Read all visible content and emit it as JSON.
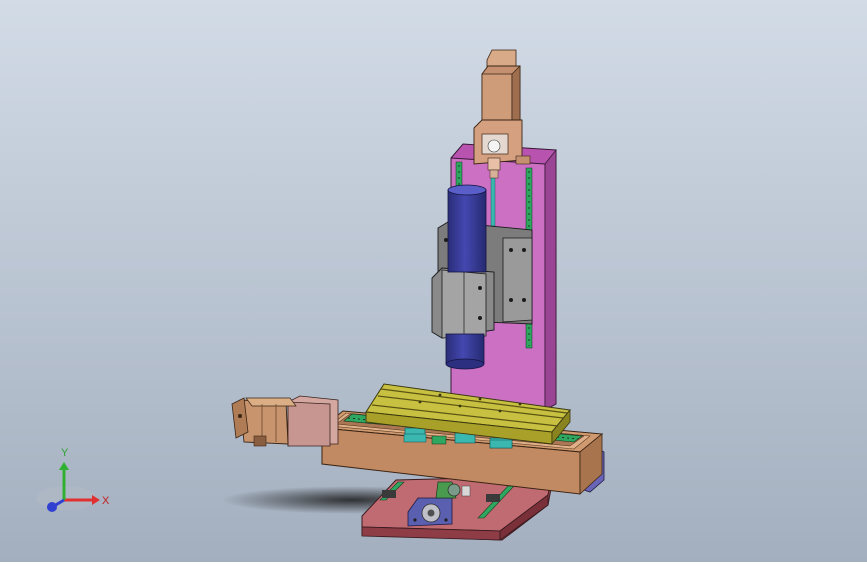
{
  "view": {
    "background_top": "#d2dbe6",
    "background_bottom": "#a2aebe"
  },
  "model": {
    "colors": {
      "base_red": "#b05a62",
      "table_tan": "#c08860",
      "worktable_olive": "#b8ae30",
      "column_magenta": "#c868c0",
      "spindle_blue": "#3a3e9a",
      "motor_tan": "#c29070",
      "head_gray": "#8c8c8c",
      "rail_green": "#2ea860",
      "ballscrew_teal": "#50b8b0"
    }
  },
  "triad": {
    "x_label": "X",
    "y_label": "Y",
    "x_color": "#e03030",
    "y_color": "#30b030",
    "z_color": "#3040d0"
  }
}
